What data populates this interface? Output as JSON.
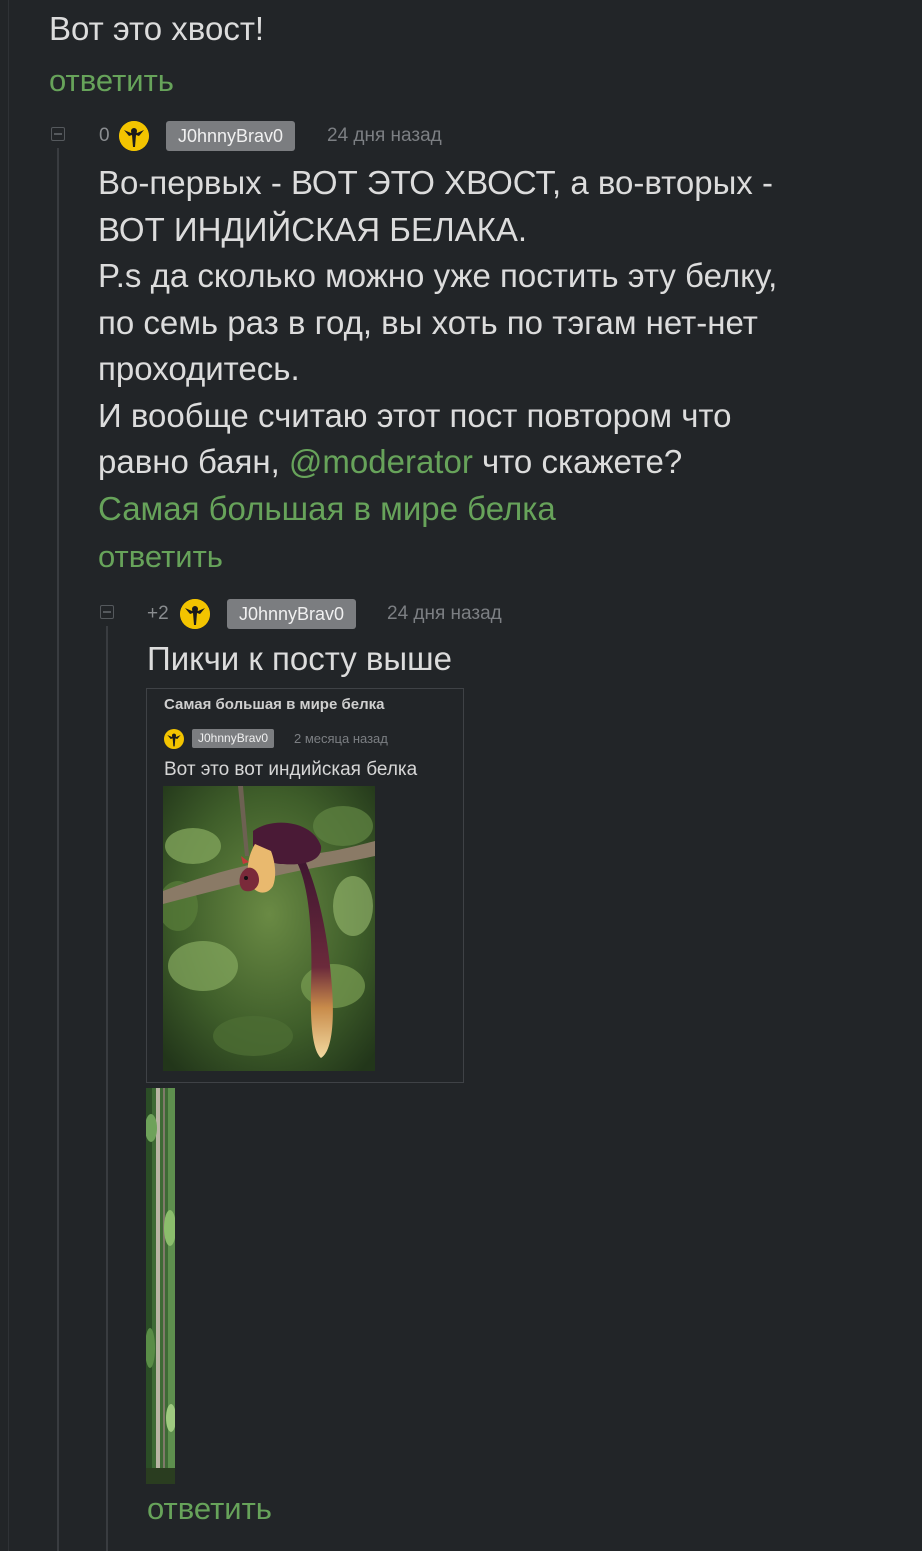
{
  "top_comment": {
    "text": "Вот это хвост!",
    "reply_label": "ответить"
  },
  "comment1": {
    "rating": "0",
    "author": "J0hnnyBrav0",
    "time": "24 дня назад",
    "lines": [
      "Во-первых - ВОТ ЭТО ХВОСТ, а во-вторых -",
      "ВОТ ИНДИЙСКАЯ БЕЛАКА.",
      "P.s да сколько можно уже постить эту белку,",
      "по семь раз в год, вы хоть по тэгам нет-нет",
      "проходитесь.",
      "И вообще считаю этот пост повтором что"
    ],
    "last_line_prefix": "равно баян, ",
    "mention": "@moderator",
    "last_line_suffix": " что скажете?",
    "post_link": "Самая большая в мире белка",
    "reply_label": "ответить"
  },
  "comment2": {
    "rating": "+2",
    "author": "J0hnnyBrav0",
    "time": "24 дня назад",
    "text": "Пикчи к посту выше",
    "quote": {
      "title": "Самая большая в мире белка",
      "author": "J0hnnyBrav0",
      "time": "2 месяца назад",
      "text": "Вот это вот индийская белка"
    },
    "reply_label": "ответить"
  },
  "colors": {
    "background": "#222528",
    "link_green": "#67a35a",
    "badge_gray": "#7b7d80",
    "avatar_yellow": "#f3c400"
  },
  "icons": [
    "collapse-icon",
    "avatar-icon"
  ]
}
